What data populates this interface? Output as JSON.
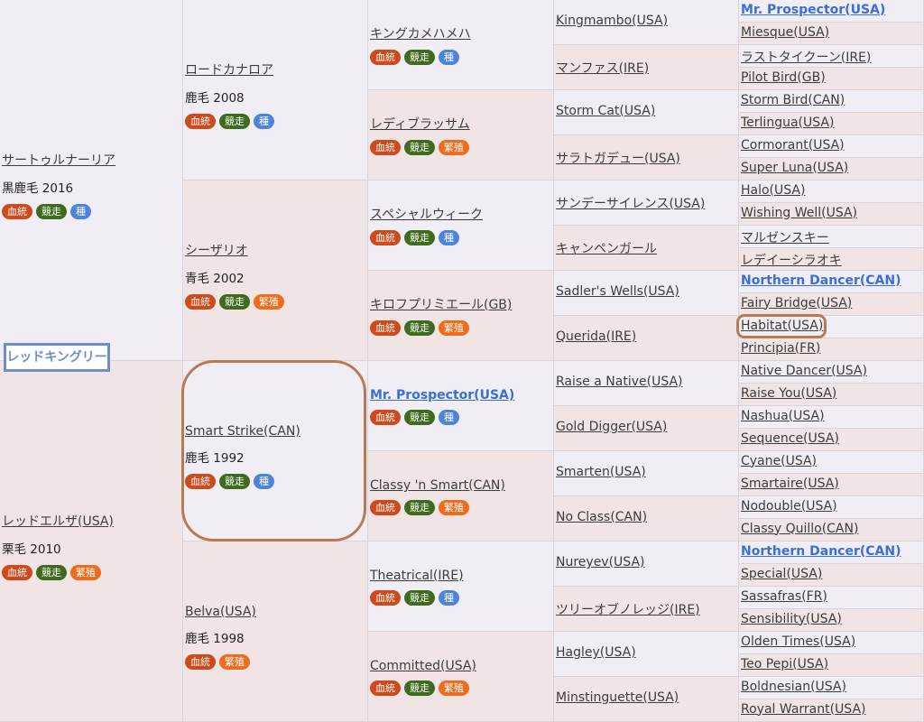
{
  "horse_name": "レッドキングリー",
  "tag_labels": {
    "blood": "血統",
    "race": "競走",
    "sire": "種",
    "mare": "繁殖"
  },
  "gen1": [
    {
      "name": "サートゥルナーリア",
      "info": "黒鹿毛 2016",
      "tags": [
        "blood",
        "race",
        "sire"
      ]
    },
    {
      "name": "レッドエルザ(USA)",
      "info": "栗毛 2010",
      "tags": [
        "blood",
        "race",
        "mare"
      ]
    }
  ],
  "gen2": [
    {
      "name": "ロードカナロア",
      "info": "鹿毛 2008",
      "tags": [
        "blood",
        "race",
        "sire"
      ]
    },
    {
      "name": "シーザリオ",
      "info": "青毛 2002",
      "tags": [
        "blood",
        "race",
        "mare"
      ]
    },
    {
      "name": "Smart Strike(CAN)",
      "info": "鹿毛 1992",
      "tags": [
        "blood",
        "race",
        "sire"
      ]
    },
    {
      "name": "Belva(USA)",
      "info": "鹿毛 1998",
      "tags": [
        "blood",
        "mare"
      ]
    }
  ],
  "gen3": [
    {
      "name": "キングカメハメハ",
      "tags": [
        "blood",
        "race",
        "sire"
      ],
      "bold": false
    },
    {
      "name": "レディブラッサム",
      "tags": [
        "blood",
        "race",
        "mare"
      ],
      "bold": false
    },
    {
      "name": "スペシャルウィーク",
      "tags": [
        "blood",
        "race",
        "sire"
      ],
      "bold": false
    },
    {
      "name": "キロフプリミエール(GB)",
      "tags": [
        "blood",
        "race",
        "mare"
      ],
      "bold": false
    },
    {
      "name": "Mr. Prospector(USA)",
      "tags": [
        "blood",
        "race",
        "sire"
      ],
      "bold": true
    },
    {
      "name": "Classy 'n Smart(CAN)",
      "tags": [
        "blood",
        "race",
        "mare"
      ],
      "bold": false
    },
    {
      "name": "Theatrical(IRE)",
      "tags": [
        "blood",
        "race",
        "sire"
      ],
      "bold": false
    },
    {
      "name": "Committed(USA)",
      "tags": [
        "blood",
        "race",
        "mare"
      ],
      "bold": false
    }
  ],
  "gen4": [
    "Kingmambo(USA)",
    "マンファス(IRE)",
    "Storm Cat(USA)",
    "サラトガデュー(USA)",
    "サンデーサイレンス(USA)",
    "キャンペンガール",
    "Sadler's Wells(USA)",
    "Querida(IRE)",
    "Raise a Native(USA)",
    "Gold Digger(USA)",
    "Smarten(USA)",
    "No Class(CAN)",
    "Nureyev(USA)",
    "ツリーオブノレッジ(IRE)",
    "Hagley(USA)",
    "Minstinguette(USA)"
  ],
  "gen5": [
    {
      "name": "Mr. Prospector(USA)",
      "bold": true
    },
    {
      "name": "Miesque(USA)",
      "bold": false
    },
    {
      "name": "ラストタイクーン(IRE)",
      "bold": false
    },
    {
      "name": "Pilot Bird(GB)",
      "bold": false
    },
    {
      "name": "Storm Bird(CAN)",
      "bold": false
    },
    {
      "name": "Terlingua(USA)",
      "bold": false
    },
    {
      "name": "Cormorant(USA)",
      "bold": false
    },
    {
      "name": "Super Luna(USA)",
      "bold": false
    },
    {
      "name": "Halo(USA)",
      "bold": false
    },
    {
      "name": "Wishing Well(USA)",
      "bold": false
    },
    {
      "name": "マルゼンスキー",
      "bold": false
    },
    {
      "name": "レデイーシラオキ",
      "bold": false
    },
    {
      "name": "Northern Dancer(CAN)",
      "bold": true
    },
    {
      "name": "Fairy Bridge(USA)",
      "bold": false
    },
    {
      "name": "Habitat(USA)",
      "bold": false
    },
    {
      "name": "Principia(FR)",
      "bold": false
    },
    {
      "name": "Native Dancer(USA)",
      "bold": false
    },
    {
      "name": "Raise You(USA)",
      "bold": false
    },
    {
      "name": "Nashua(USA)",
      "bold": false
    },
    {
      "name": "Sequence(USA)",
      "bold": false
    },
    {
      "name": "Cyane(USA)",
      "bold": false
    },
    {
      "name": "Smartaire(USA)",
      "bold": false
    },
    {
      "name": "Nodouble(USA)",
      "bold": false
    },
    {
      "name": "Classy Quillo(CAN)",
      "bold": false
    },
    {
      "name": "Northern Dancer(CAN)",
      "bold": true
    },
    {
      "name": "Special(USA)",
      "bold": false
    },
    {
      "name": "Sassafras(FR)",
      "bold": false
    },
    {
      "name": "Sensibility(USA)",
      "bold": false
    },
    {
      "name": "Olden Times(USA)",
      "bold": false
    },
    {
      "name": "Teo Pepi(USA)",
      "bold": false
    },
    {
      "name": "Boldnesian(USA)",
      "bold": false
    },
    {
      "name": "Royal Warrant(USA)",
      "bold": false
    }
  ]
}
